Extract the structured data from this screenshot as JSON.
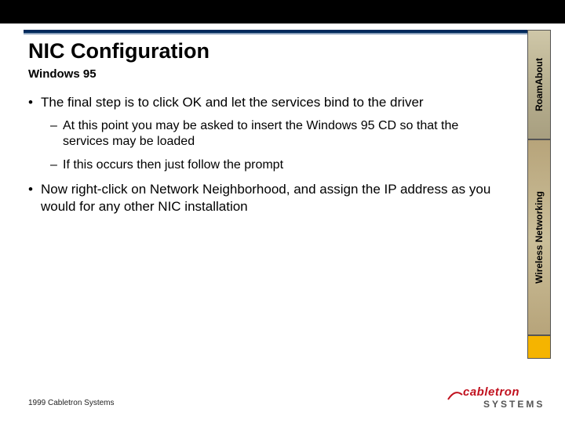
{
  "title": "NIC Configuration",
  "subtitle": "Windows 95",
  "bullets": {
    "b1a": "The final step is to click OK and let the services bind to the driver",
    "b2a": "At this point you may be asked to insert the Windows 95 CD so that the services may be loaded",
    "b2b": "If this occurs then just follow the prompt",
    "b1b": "Now right-click on Network Neighborhood, and assign the IP address as you would for any other NIC installation"
  },
  "sidebar": {
    "label_top": "RoamAbout",
    "label_mid": "Wireless Networking"
  },
  "footer": {
    "copyright": "1999 Cabletron Systems"
  },
  "logo": {
    "word1": "cabletron",
    "word2": "SYSTEMS"
  },
  "colors": {
    "rule_dark": "#002a5c",
    "accent_yellow": "#f5b400",
    "logo_red": "#c1121f"
  }
}
